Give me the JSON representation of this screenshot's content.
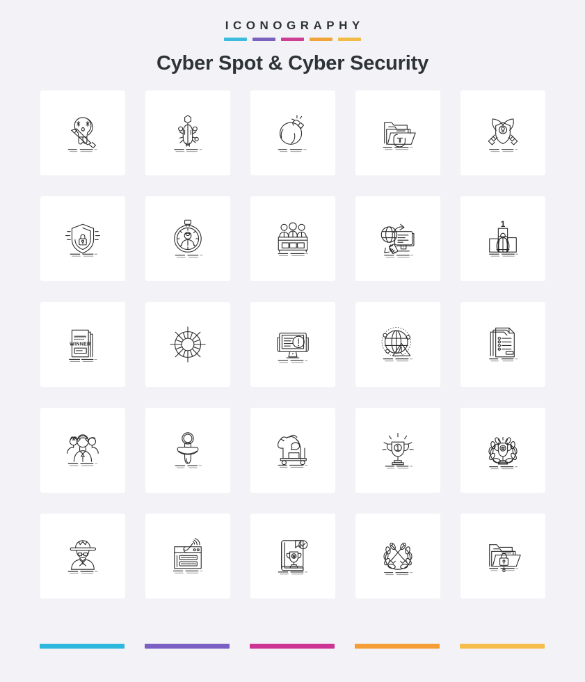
{
  "header": {
    "eyebrow": "ICONOGRAPHY",
    "title": "Cyber Spot & Cyber Security",
    "accent_bars": [
      "#3bbcdc",
      "#7862bd",
      "#cc3f93",
      "#f0a43a",
      "#f2bb47"
    ]
  },
  "footer": {
    "accent_bars": [
      "#2fb8dd",
      "#7b5fc4",
      "#cc3593",
      "#f59e36",
      "#f6bd4a"
    ]
  },
  "grid": {
    "columns": 5,
    "rows": 5,
    "icons": [
      {
        "name": "skull-sword-icon",
        "label": "Skull with sword"
      },
      {
        "name": "bug-beetle-icon",
        "label": "Beetle bug"
      },
      {
        "name": "bomb-icon",
        "label": "Bomb"
      },
      {
        "name": "folder-magnet-icon",
        "label": "Folder with magnet"
      },
      {
        "name": "shield-rifles-icon",
        "label": "Shield with crossed rifles"
      },
      {
        "name": "shield-lock-icon",
        "label": "Shield with padlock"
      },
      {
        "name": "stopwatch-user-icon",
        "label": "Stopwatch with user"
      },
      {
        "name": "jury-panel-icon",
        "label": "Jury panel"
      },
      {
        "name": "global-data-sync-icon",
        "label": "Globe and monitor sync"
      },
      {
        "name": "podium-first-place-icon",
        "label": "Winner podium",
        "text": "1"
      },
      {
        "name": "winner-certificate-icon",
        "label": "Winner certificate",
        "text": "WINNER"
      },
      {
        "name": "lifebuoy-icon",
        "label": "Lifebuoy"
      },
      {
        "name": "monitor-alert-icon",
        "label": "Monitor with alert"
      },
      {
        "name": "globe-warning-icon",
        "label": "Globe with warning"
      },
      {
        "name": "documents-list-icon",
        "label": "Document list stack"
      },
      {
        "name": "team-group-icon",
        "label": "Group of people"
      },
      {
        "name": "pacifier-icon",
        "label": "Pacifier"
      },
      {
        "name": "trojan-horse-icon",
        "label": "Trojan horse"
      },
      {
        "name": "trophy-first-icon",
        "label": "Trophy first place",
        "text": "1"
      },
      {
        "name": "trophy-laurel-icon",
        "label": "Trophy with laurel wreath"
      },
      {
        "name": "spy-hacker-icon",
        "label": "Spy hacker"
      },
      {
        "name": "phishing-browser-icon",
        "label": "Phishing browser window"
      },
      {
        "name": "award-book-icon",
        "label": "Award book with check"
      },
      {
        "name": "laurel-swords-icon",
        "label": "Laurel wreath with crossed swords"
      },
      {
        "name": "folder-lock-icon",
        "label": "Folder with padlock"
      }
    ]
  }
}
